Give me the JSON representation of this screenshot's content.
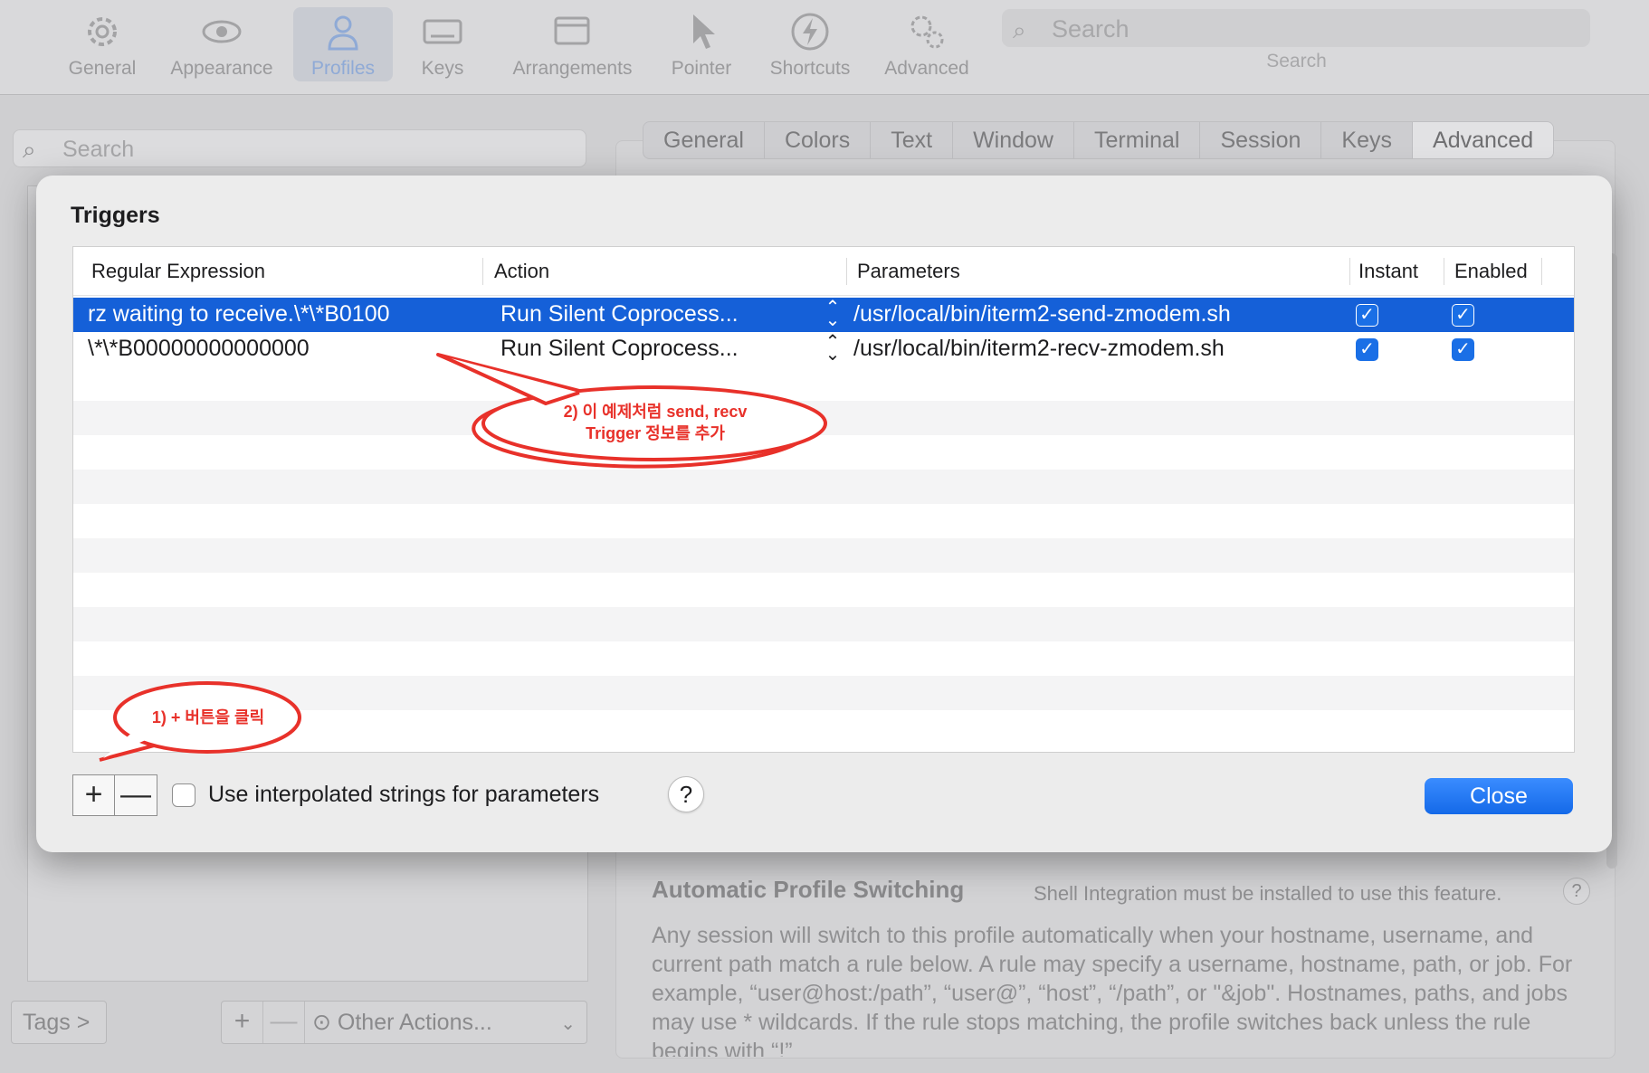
{
  "toolbar": {
    "items": [
      {
        "label": "General",
        "icon": "gear-icon"
      },
      {
        "label": "Appearance",
        "icon": "eye-icon"
      },
      {
        "label": "Profiles",
        "icon": "person-icon",
        "selected": true
      },
      {
        "label": "Keys",
        "icon": "keyboard-icon"
      },
      {
        "label": "Arrangements",
        "icon": "windows-icon"
      },
      {
        "label": "Pointer",
        "icon": "pointer-icon"
      },
      {
        "label": "Shortcuts",
        "icon": "bolt-icon"
      },
      {
        "label": "Advanced",
        "icon": "gears-icon"
      }
    ],
    "search_placeholder": "Search",
    "search_label": "Search"
  },
  "profiles": {
    "search_placeholder": "Search",
    "tags_label": "Tags >",
    "add_label": "+",
    "remove_label": "—",
    "other_actions_label": "Other Actions..."
  },
  "settings_tabs": [
    "General",
    "Colors",
    "Text",
    "Window",
    "Terminal",
    "Session",
    "Keys",
    "Advanced"
  ],
  "selected_tab": "Advanced",
  "auto_profile_switching": {
    "title": "Automatic Profile Switching",
    "note": "Shell Integration must be installed to use this feature.",
    "help": "?",
    "body": "Any session will switch to this profile automatically when your hostname, username, and current path match a rule below. A rule may specify a username, hostname, path, or job. For example, “user@host:/path”, “user@”, “host”, “/path”, or \"&job\". Hostnames, paths, and jobs may use * wildcards. If the rule stops matching, the profile switches back unless the rule begins with “!”"
  },
  "triggers": {
    "title": "Triggers",
    "columns": [
      "Regular Expression",
      "Action",
      "Parameters",
      "Instant",
      "Enabled"
    ],
    "rows": [
      {
        "regex": "rz waiting to receive.\\*\\*B0100",
        "action": "Run Silent Coprocess...",
        "parameters": "/usr/local/bin/iterm2-send-zmodem.sh",
        "instant": true,
        "enabled": true,
        "selected": true
      },
      {
        "regex": "\\*\\*B00000000000000",
        "action": "Run Silent Coprocess...",
        "parameters": "/usr/local/bin/iterm2-recv-zmodem.sh",
        "instant": true,
        "enabled": true,
        "selected": false
      }
    ],
    "add_label": "+",
    "remove_label": "—",
    "interpolated_label": "Use interpolated strings for parameters",
    "help_label": "?",
    "close_label": "Close"
  },
  "annotations": {
    "callout1": "1)  +  버튼을 클릭",
    "callout2_line1": "2)  이 예제처럼 send, recv",
    "callout2_line2": "Trigger 정보를 추가",
    "color": "#e8312a"
  }
}
